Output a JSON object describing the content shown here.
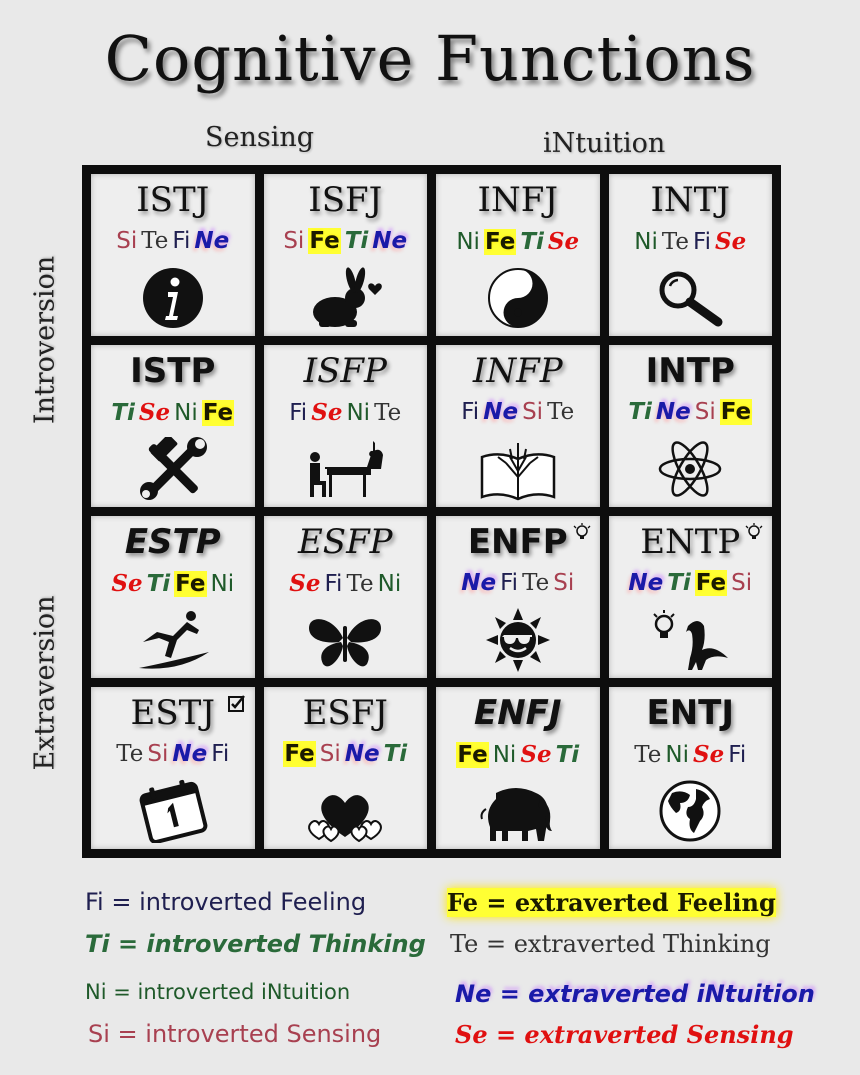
{
  "title": "Cognitive Functions",
  "col_headers": {
    "left": "Sensing",
    "right": "iNtuition"
  },
  "row_headers": {
    "top": "Introversion",
    "bottom": "Extraversion"
  },
  "cells": [
    {
      "type": "ISTJ",
      "style": "plain",
      "funcs": [
        "Si",
        "Te",
        "Fi",
        "Ne"
      ],
      "icon": "info-icon"
    },
    {
      "type": "ISFJ",
      "style": "plain",
      "funcs": [
        "Si",
        "Fe",
        "Ti",
        "Ne"
      ],
      "icon": "rabbit-heart-icon"
    },
    {
      "type": "INFJ",
      "style": "plain",
      "funcs": [
        "Ni",
        "Fe",
        "Ti",
        "Se"
      ],
      "icon": "yin-yang-icon"
    },
    {
      "type": "INTJ",
      "style": "plain",
      "funcs": [
        "Ni",
        "Te",
        "Fi",
        "Se"
      ],
      "icon": "magnifying-glass-icon"
    },
    {
      "type": "ISTP",
      "style": "bold",
      "funcs": [
        "Ti",
        "Se",
        "Ni",
        "Fe"
      ],
      "icon": "hammer-wrench-icon"
    },
    {
      "type": "ISFP",
      "style": "ital",
      "funcs": [
        "Fi",
        "Se",
        "Ni",
        "Te"
      ],
      "icon": "pianist-icon"
    },
    {
      "type": "INFP",
      "style": "ital",
      "funcs": [
        "Fi",
        "Ne",
        "Si",
        "Te"
      ],
      "icon": "book-tree-icon"
    },
    {
      "type": "INTP",
      "style": "bold",
      "funcs": [
        "Ti",
        "Ne",
        "Si",
        "Fe"
      ],
      "icon": "atom-icon"
    },
    {
      "type": "ESTP",
      "style": "boldital",
      "funcs": [
        "Se",
        "Ti",
        "Fe",
        "Ni"
      ],
      "icon": "surfer-icon"
    },
    {
      "type": "ESFP",
      "style": "ital",
      "funcs": [
        "Se",
        "Fi",
        "Te",
        "Ni"
      ],
      "icon": "butterfly-icon"
    },
    {
      "type": "ENFP",
      "style": "bold",
      "funcs": [
        "Ne",
        "Fi",
        "Te",
        "Si"
      ],
      "icon": "sun-sunglasses-icon",
      "corner": "lightbulb-icon"
    },
    {
      "type": "ENTP",
      "style": "plain",
      "funcs": [
        "Ne",
        "Ti",
        "Fe",
        "Si"
      ],
      "icon": "lightbulb-seamonster-icon",
      "corner": "lightbulb-icon"
    },
    {
      "type": "ESTJ",
      "style": "plain",
      "funcs": [
        "Te",
        "Si",
        "Ne",
        "Fi"
      ],
      "icon": "calendar-icon",
      "corner": "checkbox-icon"
    },
    {
      "type": "ESFJ",
      "style": "plain",
      "funcs": [
        "Fe",
        "Si",
        "Ne",
        "Ti"
      ],
      "icon": "hearts-icon"
    },
    {
      "type": "ENFJ",
      "style": "boldital",
      "funcs": [
        "Fe",
        "Ni",
        "Se",
        "Ti"
      ],
      "icon": "elephant-icon"
    },
    {
      "type": "ENTJ",
      "style": "bold",
      "funcs": [
        "Te",
        "Ni",
        "Se",
        "Fi"
      ],
      "icon": "globe-icon"
    }
  ],
  "legend": [
    {
      "code": "Fi",
      "text": "Fi = introverted Feeling"
    },
    {
      "code": "Fe",
      "text": "Fe = extraverted Feeling"
    },
    {
      "code": "Ti",
      "text": "Ti = introverted Thinking"
    },
    {
      "code": "Te",
      "text": "Te = extraverted Thinking"
    },
    {
      "code": "Ni",
      "text": "Ni = introverted iNtuition"
    },
    {
      "code": "Ne",
      "text": "Ne = extraverted iNtuition"
    },
    {
      "code": "Si",
      "text": "Si = introverted Sensing"
    },
    {
      "code": "Se",
      "text": "Se = extraverted Sensing"
    }
  ]
}
